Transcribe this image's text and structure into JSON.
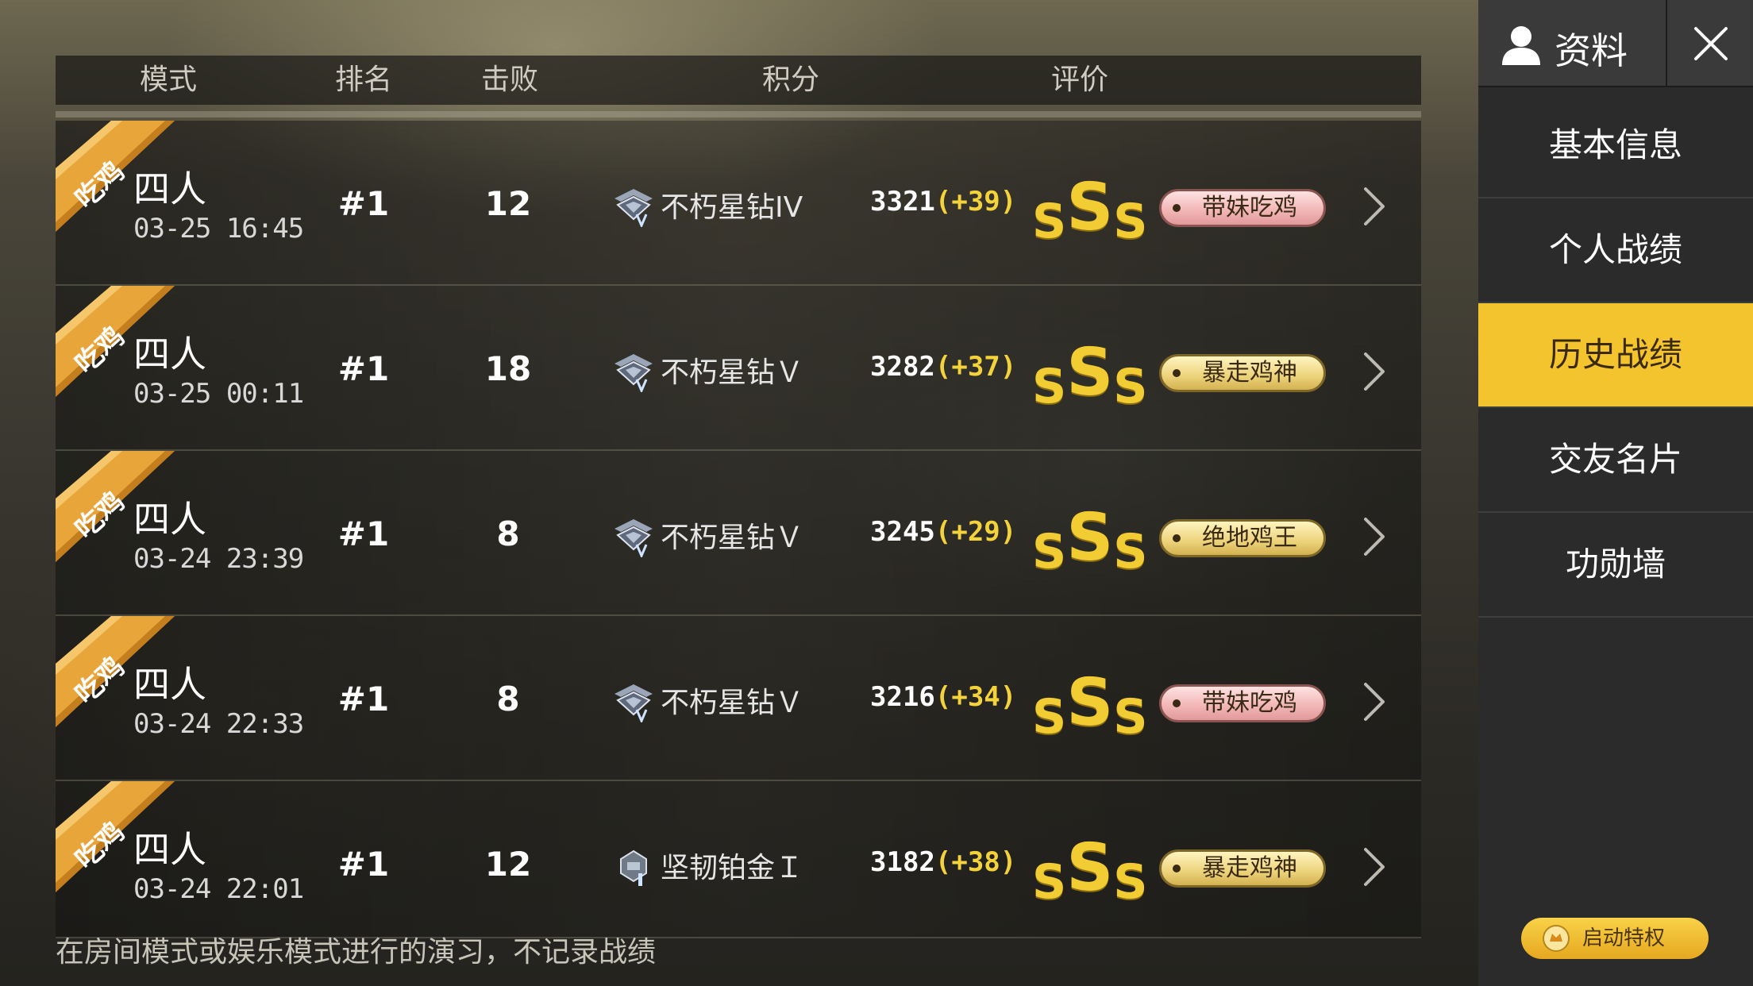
{
  "table": {
    "headers": {
      "mode": "模式",
      "rank": "排名",
      "kills": "击败",
      "points": "积分",
      "rating": "评价"
    },
    "rows": [
      {
        "ribbon": "吃鸡",
        "mode": "四人",
        "datetime": "03-25 16:45",
        "rank": "#1",
        "kills": "12",
        "tier_icon": "diamond-tier-icon",
        "tier": "不朽星钻IV",
        "score": "3321",
        "gain": "(+39)",
        "grade": [
          "S",
          "S",
          "S"
        ],
        "badge": "带妹吃鸡",
        "badge_style": "pink"
      },
      {
        "ribbon": "吃鸡",
        "mode": "四人",
        "datetime": "03-25 00:11",
        "rank": "#1",
        "kills": "18",
        "tier_icon": "diamond-tier-icon",
        "tier": "不朽星钻Ｖ",
        "score": "3282",
        "gain": "(+37)",
        "grade": [
          "S",
          "S",
          "S"
        ],
        "badge": "暴走鸡神",
        "badge_style": "gold"
      },
      {
        "ribbon": "吃鸡",
        "mode": "四人",
        "datetime": "03-24 23:39",
        "rank": "#1",
        "kills": "8",
        "tier_icon": "diamond-tier-icon",
        "tier": "不朽星钻Ｖ",
        "score": "3245",
        "gain": "(+29)",
        "grade": [
          "S",
          "S",
          "S"
        ],
        "badge": "绝地鸡王",
        "badge_style": "gold"
      },
      {
        "ribbon": "吃鸡",
        "mode": "四人",
        "datetime": "03-24 22:33",
        "rank": "#1",
        "kills": "8",
        "tier_icon": "diamond-tier-icon",
        "tier": "不朽星钻Ｖ",
        "score": "3216",
        "gain": "(+34)",
        "grade": [
          "S",
          "S",
          "S"
        ],
        "badge": "带妹吃鸡",
        "badge_style": "pink"
      },
      {
        "ribbon": "吃鸡",
        "mode": "四人",
        "datetime": "03-24 22:01",
        "rank": "#1",
        "kills": "12",
        "tier_icon": "platinum-tier-icon",
        "tier": "坚韧铂金Ｉ",
        "score": "3182",
        "gain": "(+38)",
        "grade": [
          "S",
          "S",
          "S"
        ],
        "badge": "暴走鸡神",
        "badge_style": "gold"
      }
    ]
  },
  "footer_note": "在房间模式或娱乐模式进行的演习，不记录战绩",
  "sidebar": {
    "profile_label": "资料",
    "profile_icon": "user-icon",
    "close_icon": "close-icon",
    "items": [
      {
        "label": "基本信息",
        "active": false
      },
      {
        "label": "个人战绩",
        "active": false
      },
      {
        "label": "历史战绩",
        "active": true
      },
      {
        "label": "交友名片",
        "active": false
      },
      {
        "label": "功勋墙",
        "active": false
      }
    ],
    "privilege_label": "启动特权"
  },
  "colors": {
    "accent": "#f3c42d",
    "grade": "#f2cc33",
    "gain": "#f4d23a",
    "ribbon": "#e8a53a"
  }
}
